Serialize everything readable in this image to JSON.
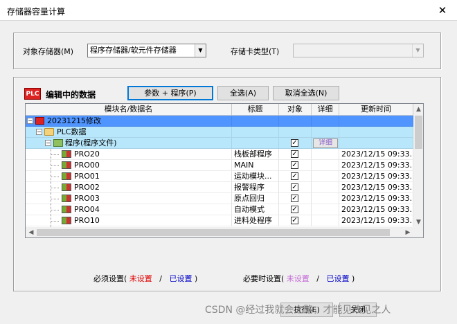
{
  "window": {
    "title": "存储器容量计算",
    "close_glyph": "✕"
  },
  "settings": {
    "target_memory_label": "对象存储器(M)",
    "target_memory_value": "程序存储器/软元件存储器",
    "card_type_label": "存储卡类型(T)",
    "card_type_value": ""
  },
  "editing": {
    "icon_text": "PLC",
    "title": "编辑中的数据",
    "btn_params_program": "参数 + 程序(P)",
    "btn_select_all": "全选(A)",
    "btn_deselect_all": "取消全选(N)"
  },
  "grid": {
    "columns": [
      "模块名/数据名",
      "标题",
      "对象",
      "详细",
      "更新时间"
    ],
    "root": {
      "name": "20231215修改"
    },
    "plc_data": {
      "name": "PLC数据"
    },
    "program_file": {
      "name": "程序(程序文件)",
      "checked": true,
      "detail": "详细"
    },
    "rows": [
      {
        "name": "PRO20",
        "title": "栈板部程序",
        "checked": true,
        "time": "2023/12/15 09:33..."
      },
      {
        "name": "PRO00",
        "title": "MAIN",
        "checked": true,
        "time": "2023/12/15 09:33..."
      },
      {
        "name": "PRO01",
        "title": "运动模块...",
        "checked": true,
        "time": "2023/12/15 09:33..."
      },
      {
        "name": "PRO02",
        "title": "报警程序",
        "checked": true,
        "time": "2023/12/15 09:33..."
      },
      {
        "name": "PRO03",
        "title": "原点回归",
        "checked": true,
        "time": "2023/12/15 09:33..."
      },
      {
        "name": "PRO04",
        "title": "自动模式",
        "checked": true,
        "time": "2023/12/15 09:33..."
      },
      {
        "name": "PRO10",
        "title": "进料处程序",
        "checked": true,
        "time": "2023/12/15 09:33..."
      }
    ]
  },
  "legend": {
    "required_prefix": "必须设置(",
    "required_unset": "未设置",
    "sep": "/",
    "required_set": "已设置",
    "suffix": ")",
    "optional_prefix": "必要时设置(",
    "optional_unset": "未设置",
    "optional_set": "已设置",
    "color_required_unset": "#e00000",
    "color_set": "#0000c8",
    "color_optional_unset": "#c46ad6"
  },
  "footer": {
    "execute_label": "执行(E)",
    "close_label": "关闭"
  },
  "watermark": "CSDN @经过我就会之路，才能见改见之人"
}
